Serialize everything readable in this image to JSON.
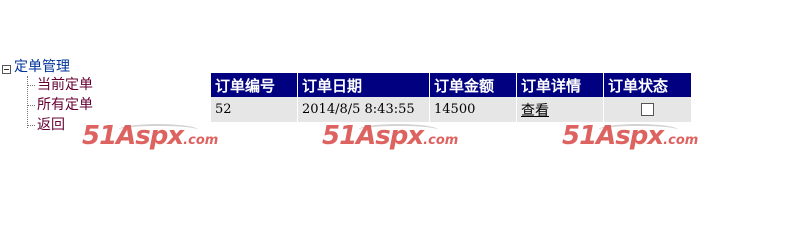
{
  "tree": {
    "root_label": "定单管理",
    "items": [
      {
        "label": "当前定单"
      },
      {
        "label": "所有定单"
      },
      {
        "label": "返回"
      }
    ]
  },
  "orders_table": {
    "headers": [
      "订单编号",
      "订单日期",
      "订单金额",
      "订单详情",
      "订单状态"
    ],
    "rows": [
      {
        "id": "52",
        "date": "2014/8/5 8:43:55",
        "amount": "14500",
        "detail_link": "查看",
        "status_checked": false
      }
    ]
  },
  "watermark": {
    "brand_main": "51Aspx",
    "brand_suffix": ".com",
    "color": "#d9534f"
  }
}
